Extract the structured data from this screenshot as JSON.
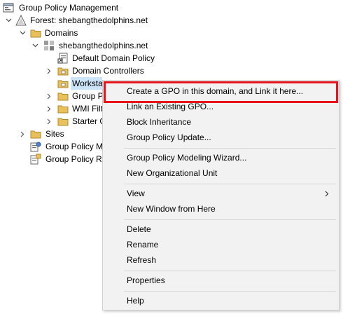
{
  "tree": {
    "root": "Group Policy Management",
    "forest": "Forest: shebangthedolphins.net",
    "domains": "Domains",
    "domain": "shebangthedolphins.net",
    "default_policy": "Default Domain Policy",
    "domain_controllers": "Domain Controllers",
    "workstations": "Workstations",
    "group_policy_objects": "Group Policy Objects",
    "wmi_filters": "WMI Filters",
    "starter_gpos": "Starter GPOs",
    "sites": "Sites",
    "modeling": "Group Policy Modeling",
    "results": "Group Policy Results"
  },
  "menu": {
    "create_gpo": "Create a GPO in this domain, and Link it here...",
    "link_existing": "Link an Existing GPO...",
    "block_inheritance": "Block Inheritance",
    "gp_update": "Group Policy Update...",
    "modeling_wizard": "Group Policy Modeling Wizard...",
    "new_ou": "New Organizational Unit",
    "view": "View",
    "new_window": "New Window from Here",
    "delete": "Delete",
    "rename": "Rename",
    "refresh": "Refresh",
    "properties": "Properties",
    "help": "Help"
  },
  "colors": {
    "highlight": "#e8141c",
    "folder": "#e8c15a"
  }
}
